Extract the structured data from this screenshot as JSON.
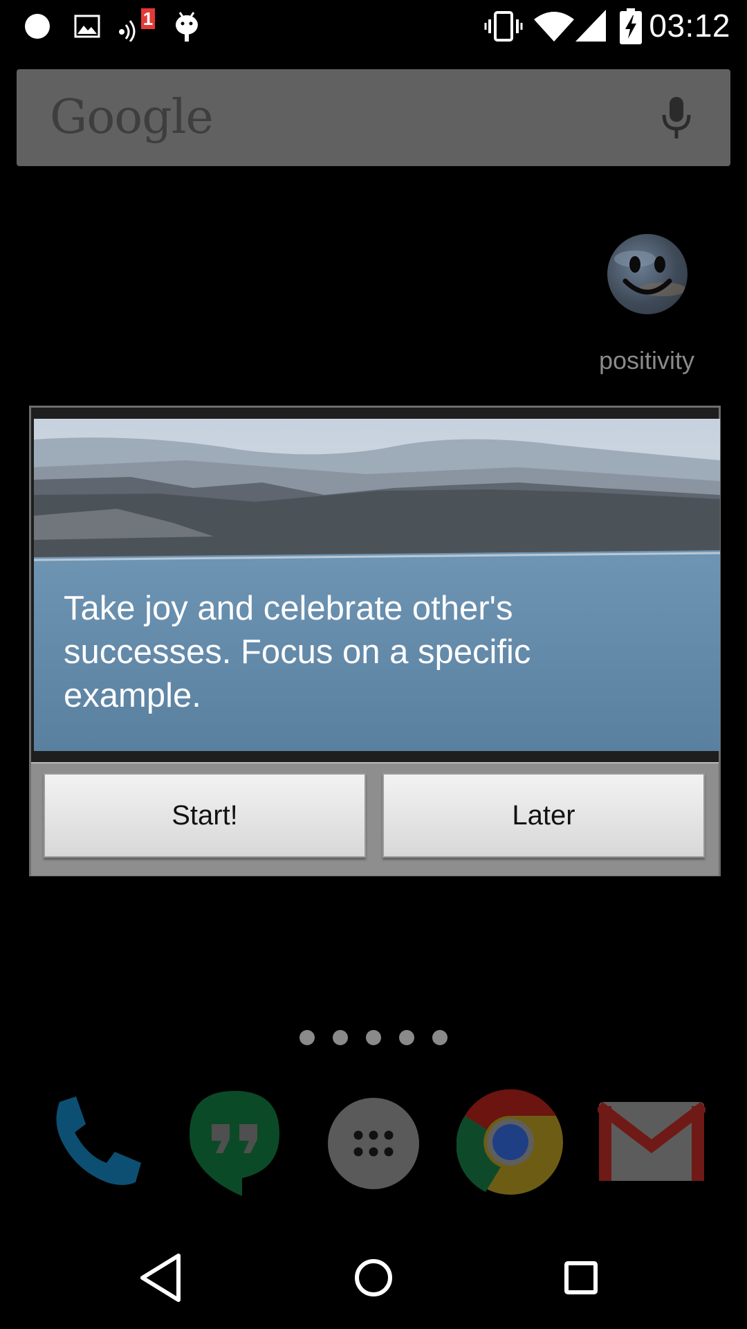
{
  "status_bar": {
    "time": "03:12",
    "notification_badge": "1",
    "icons": [
      "circle-notification-icon",
      "image-notification-icon",
      "wireless-notification-icon",
      "android-debug-icon",
      "vibrate-icon",
      "wifi-icon",
      "cell-signal-icon",
      "battery-charging-icon"
    ]
  },
  "search_widget": {
    "logo_text": "Google",
    "mic_icon": "microphone-icon"
  },
  "home_shortcut": {
    "label": "positivity",
    "icon": "smiley-face-icon"
  },
  "dialog": {
    "message": "Take joy and celebrate other's successes. Focus on a specific example.",
    "buttons": {
      "start": "Start!",
      "later": "Later"
    }
  },
  "home_pages": {
    "count": 5
  },
  "dock": {
    "apps": [
      "phone-icon",
      "hangouts-icon",
      "app-drawer-icon",
      "chrome-icon",
      "gmail-icon"
    ]
  },
  "nav_bar": {
    "buttons": [
      "back-icon",
      "home-icon",
      "recents-icon"
    ]
  }
}
